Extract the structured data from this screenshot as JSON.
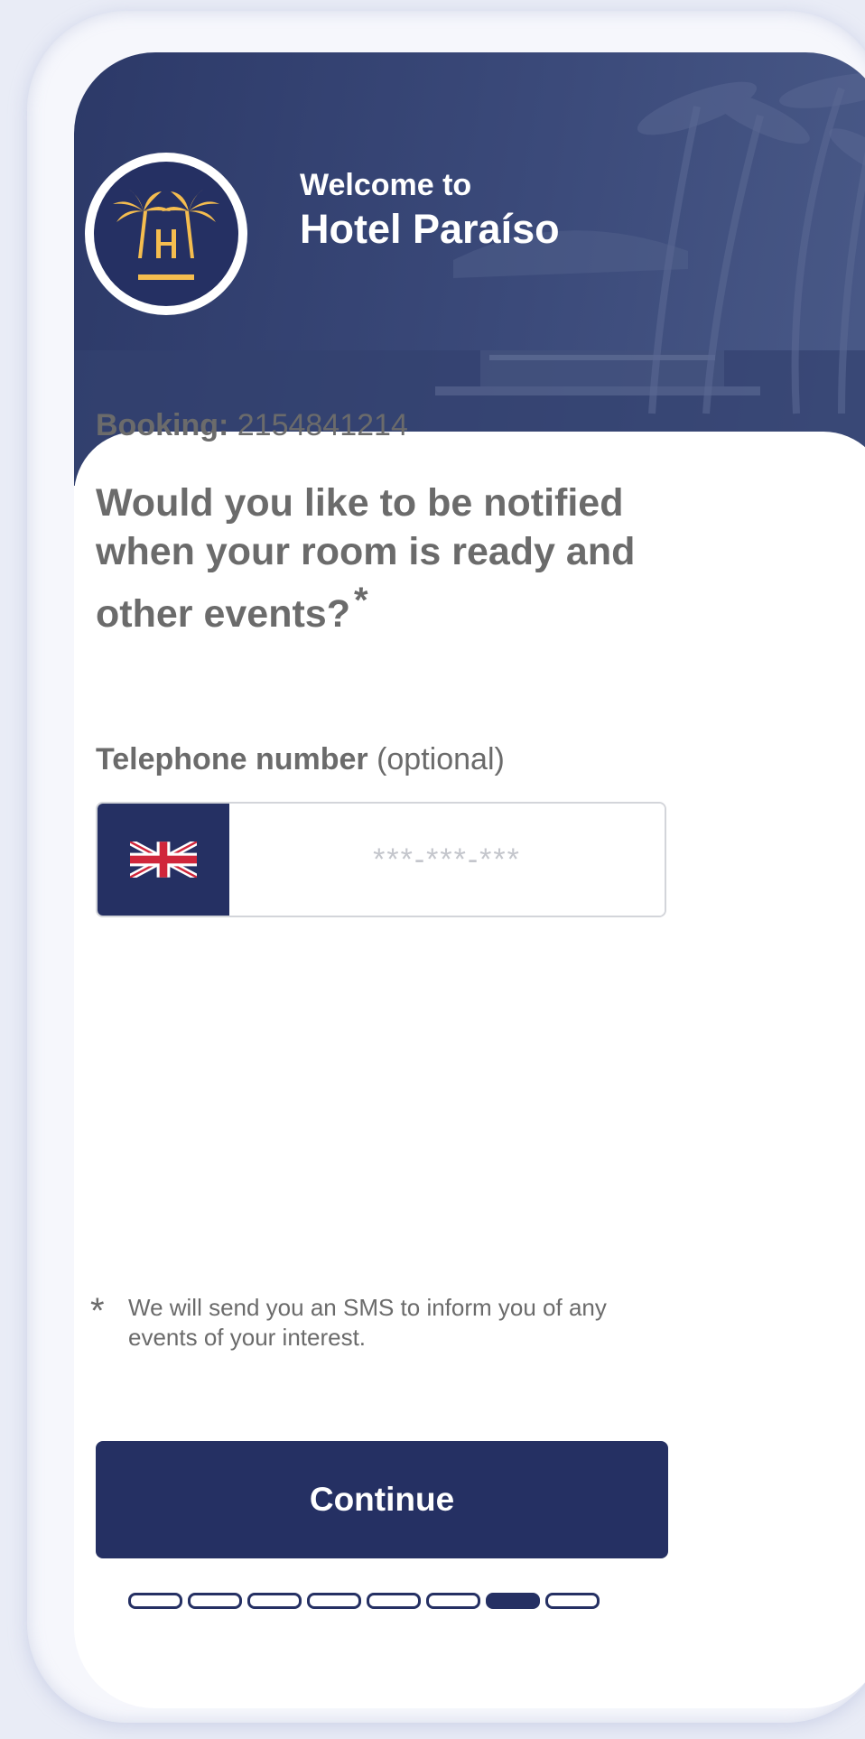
{
  "header": {
    "welcome": "Welcome to",
    "hotel_name": "Hotel Paraíso",
    "logo_icon": "palm-trees-h-logo-icon",
    "background_color": "#2c3968"
  },
  "booking": {
    "label": "Booking:",
    "number": "2154841214"
  },
  "question": {
    "text": "Would you like to be notified when your room is ready and other events?",
    "required_mark": "*"
  },
  "phone": {
    "label": "Telephone number",
    "optional": "(optional)",
    "country_icon": "uk-flag-icon",
    "placeholder": "***-***-***",
    "value": ""
  },
  "note": {
    "mark": "*",
    "text": "We will send you an SMS to inform you of any events of your interest."
  },
  "continue_label": "Continue",
  "progress": {
    "total": 8,
    "current": 7
  },
  "colors": {
    "primary": "#253063",
    "logo_gold": "#f5bd4f",
    "text": "#6b6b6b"
  }
}
